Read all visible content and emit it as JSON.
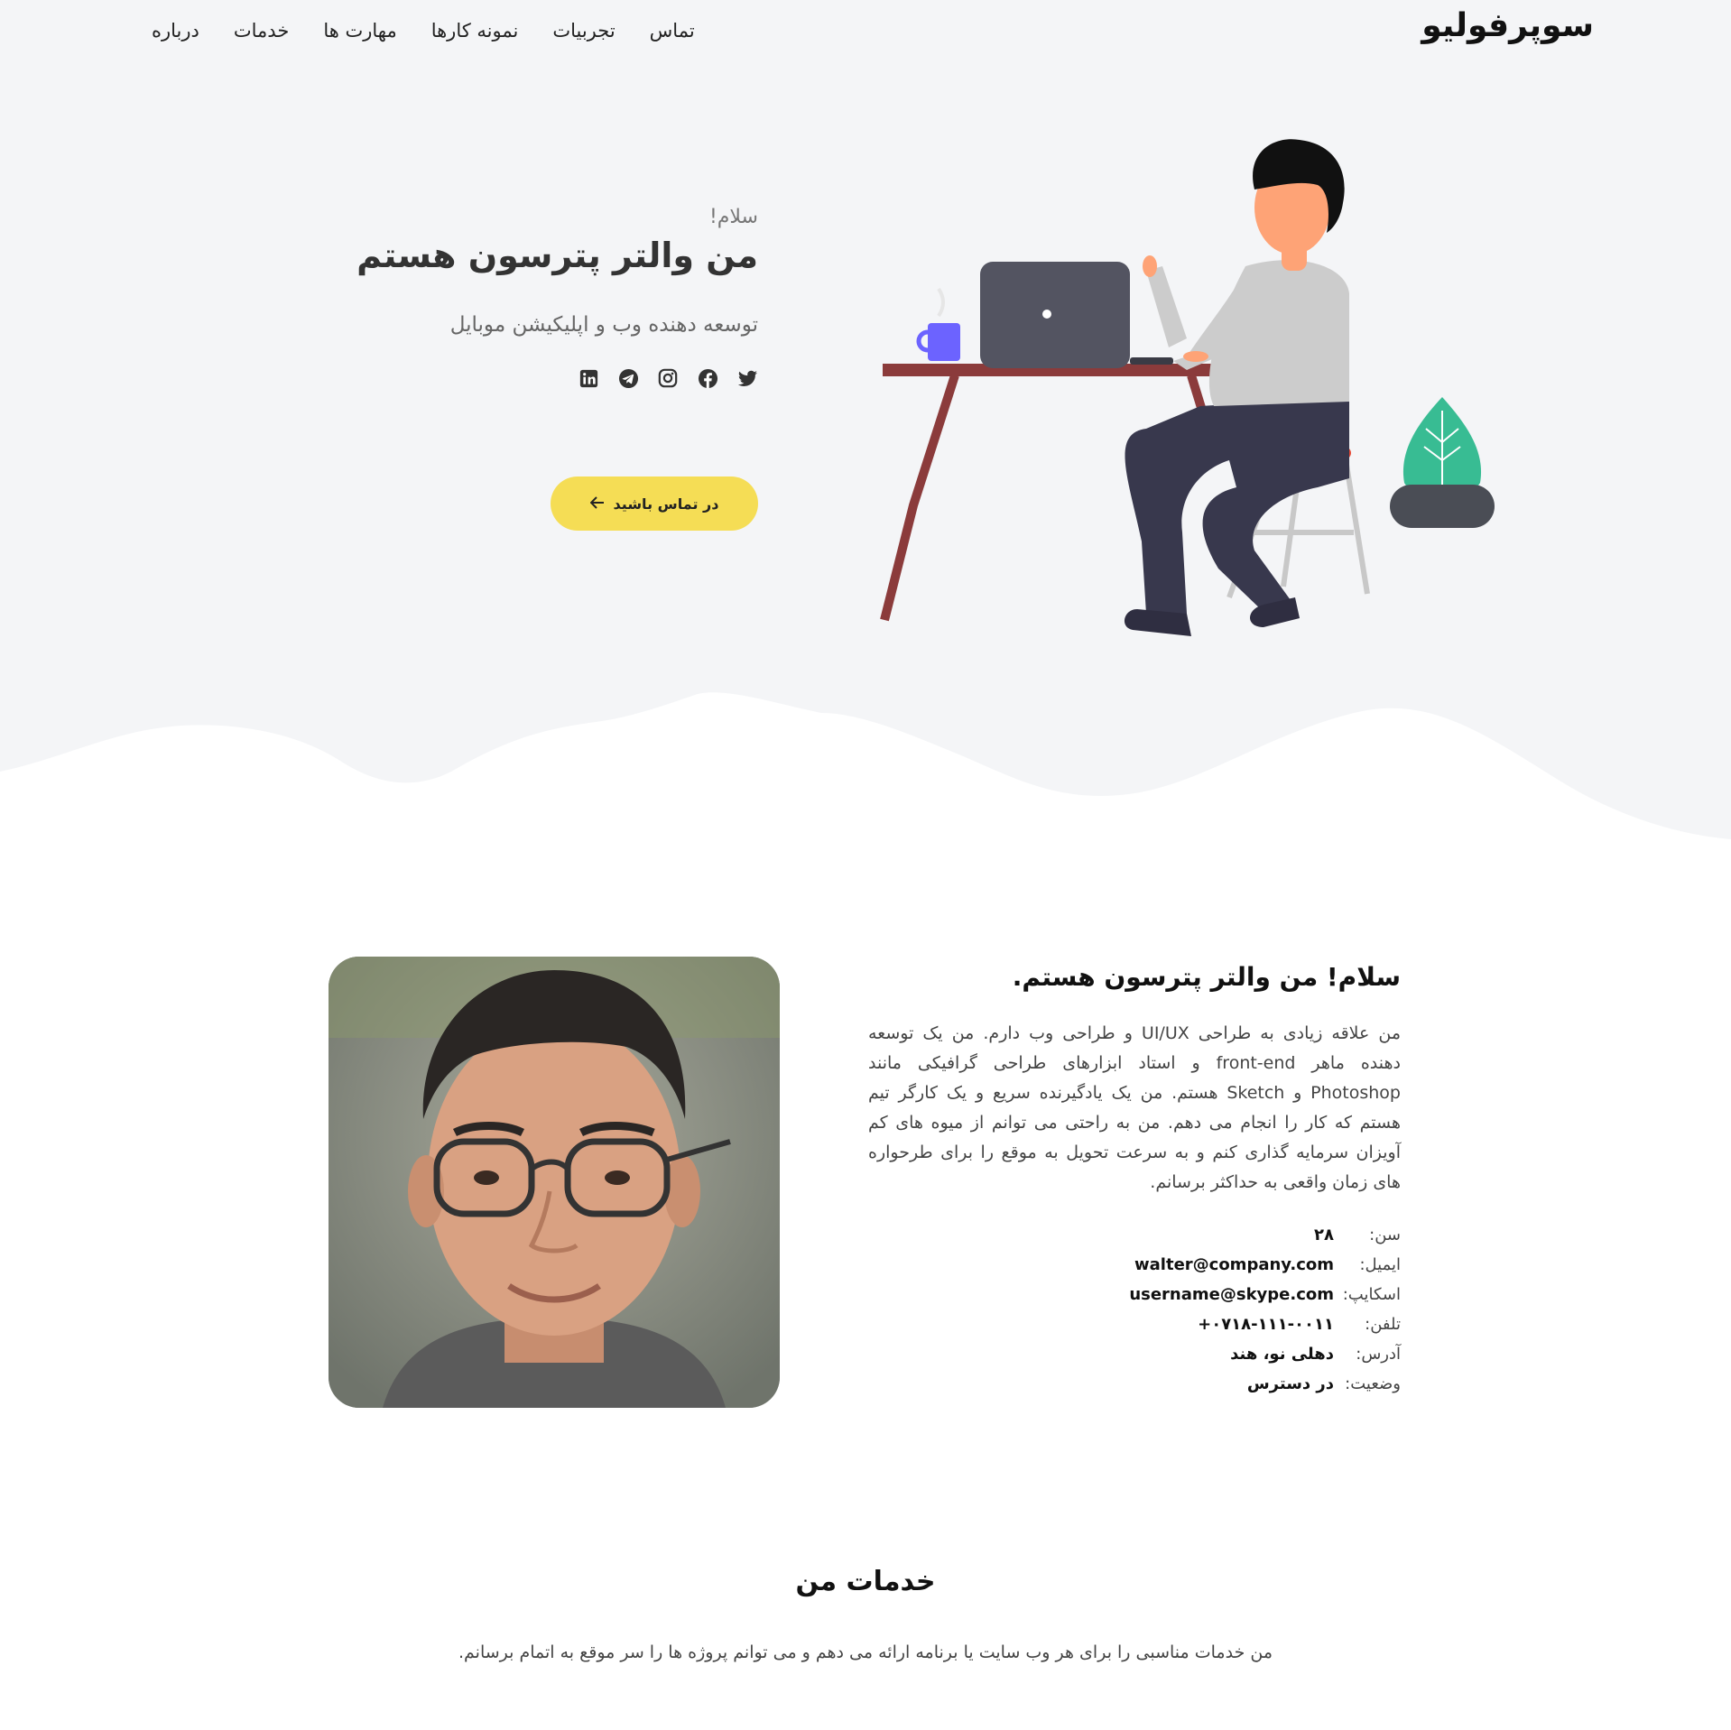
{
  "brand": "سوپرفولیو",
  "nav": [
    "درباره",
    "خدمات",
    "مهارت ها",
    "نمونه کارها",
    "تجربیات",
    "تماس"
  ],
  "hero": {
    "greeting": "سلام!",
    "title": "من والتر پترسون هستم",
    "subtitle": "توسعه دهنده وب و اپلیکیشن موبایل",
    "cta": "در تماس باشید",
    "socials": [
      "twitter-icon",
      "facebook-icon",
      "instagram-icon",
      "telegram-icon",
      "linkedin-icon"
    ]
  },
  "about": {
    "heading": "سلام! من والتر پترسون هستم.",
    "bio": "من علاقه زیادی به طراحی UI/UX و طراحی وب دارم. من یک توسعه دهنده ماهر front-end و استاد ابزارهای طراحی گرافیکی مانند Photoshop و Sketch هستم. من یک یادگیرنده سریع و یک کارگر تیم هستم که کار را انجام می دهم. من به راحتی می توانم از میوه های کم آویزان سرمایه گذاری کنم و به سرعت تحویل به موقع را برای طرحواره های زمان واقعی به حداکثر برسانم.",
    "info": [
      {
        "label": "سن:",
        "value": "۲۸"
      },
      {
        "label": "ایمیل:",
        "value": "walter@company.com"
      },
      {
        "label": "اسکایپ:",
        "value": "username@skype.com"
      },
      {
        "label": "تلفن:",
        "value": "+۰۷۱۸-۱۱۱-۰۰۱۱"
      },
      {
        "label": "آدرس:",
        "value": "دهلی نو، هند"
      },
      {
        "label": "وضعیت:",
        "value": "در دسترس"
      }
    ]
  },
  "services": {
    "heading": "خدمات من",
    "description": "من خدمات مناسبی را برای هر وب سایت یا برنامه ارائه می دهم و می توانم پروژه ها را سر موقع به اتمام برسانم."
  },
  "colors": {
    "accent": "#f5dd55",
    "hero_bg": "#f4f5f7",
    "plant": "#38bc93",
    "desk": "#8b3b3b"
  }
}
